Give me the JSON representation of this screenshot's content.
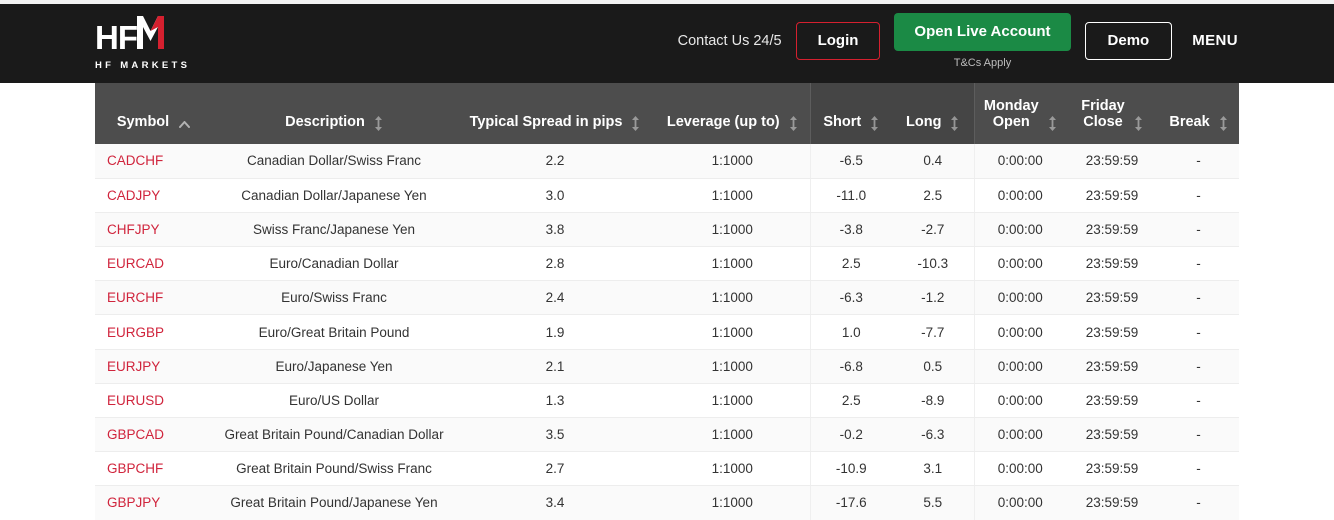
{
  "header": {
    "logo": {
      "mark": "HF",
      "mark_accent": "M",
      "sub": "HF MARKETS"
    },
    "contact_label": "Contact Us 24/5",
    "login_label": "Login",
    "open_live_label": "Open Live Account",
    "tcs_label": "T&Cs Apply",
    "demo_label": "Demo",
    "menu_label": "MENU",
    "colors": {
      "bar_background": "#1a1a1a",
      "login_border": "#d5202f",
      "live_background": "#1b8a45",
      "logo_accent": "#d5202f"
    }
  },
  "table": {
    "columns": [
      {
        "label": "Symbol",
        "sort": "asc",
        "grouped": false
      },
      {
        "label": "Description",
        "sort": "both",
        "grouped": false
      },
      {
        "label": "Typical Spread in pips",
        "sort": "both",
        "grouped": false
      },
      {
        "label": "Leverage (up to)",
        "sort": "both",
        "grouped": false
      },
      {
        "label": "Short",
        "sort": "both",
        "grouped": true
      },
      {
        "label": "Long",
        "sort": "both",
        "grouped": true
      },
      {
        "label": "Monday\nOpen",
        "sort": "both",
        "grouped": false
      },
      {
        "label": "Friday\nClose",
        "sort": "both",
        "grouped": false
      },
      {
        "label": "Break",
        "sort": "both",
        "grouped": false
      }
    ],
    "rows": [
      {
        "symbol": "CADCHF",
        "description": "Canadian Dollar/Swiss Franc",
        "spread": "2.2",
        "leverage": "1:1000",
        "short": "-6.5",
        "long": "0.4",
        "monday_open": "0:00:00",
        "friday_close": "23:59:59",
        "break": "-"
      },
      {
        "symbol": "CADJPY",
        "description": "Canadian Dollar/Japanese Yen",
        "spread": "3.0",
        "leverage": "1:1000",
        "short": "-11.0",
        "long": "2.5",
        "monday_open": "0:00:00",
        "friday_close": "23:59:59",
        "break": "-"
      },
      {
        "symbol": "CHFJPY",
        "description": "Swiss Franc/Japanese Yen",
        "spread": "3.8",
        "leverage": "1:1000",
        "short": "-3.8",
        "long": "-2.7",
        "monday_open": "0:00:00",
        "friday_close": "23:59:59",
        "break": "-"
      },
      {
        "symbol": "EURCAD",
        "description": "Euro/Canadian Dollar",
        "spread": "2.8",
        "leverage": "1:1000",
        "short": "2.5",
        "long": "-10.3",
        "monday_open": "0:00:00",
        "friday_close": "23:59:59",
        "break": "-"
      },
      {
        "symbol": "EURCHF",
        "description": "Euro/Swiss Franc",
        "spread": "2.4",
        "leverage": "1:1000",
        "short": "-6.3",
        "long": "-1.2",
        "monday_open": "0:00:00",
        "friday_close": "23:59:59",
        "break": "-"
      },
      {
        "symbol": "EURGBP",
        "description": "Euro/Great Britain Pound",
        "spread": "1.9",
        "leverage": "1:1000",
        "short": "1.0",
        "long": "-7.7",
        "monday_open": "0:00:00",
        "friday_close": "23:59:59",
        "break": "-"
      },
      {
        "symbol": "EURJPY",
        "description": "Euro/Japanese Yen",
        "spread": "2.1",
        "leverage": "1:1000",
        "short": "-6.8",
        "long": "0.5",
        "monday_open": "0:00:00",
        "friday_close": "23:59:59",
        "break": "-"
      },
      {
        "symbol": "EURUSD",
        "description": "Euro/US Dollar",
        "spread": "1.3",
        "leverage": "1:1000",
        "short": "2.5",
        "long": "-8.9",
        "monday_open": "0:00:00",
        "friday_close": "23:59:59",
        "break": "-"
      },
      {
        "symbol": "GBPCAD",
        "description": "Great Britain Pound/Canadian Dollar",
        "spread": "3.5",
        "leverage": "1:1000",
        "short": "-0.2",
        "long": "-6.3",
        "monday_open": "0:00:00",
        "friday_close": "23:59:59",
        "break": "-"
      },
      {
        "symbol": "GBPCHF",
        "description": "Great Britain Pound/Swiss Franc",
        "spread": "2.7",
        "leverage": "1:1000",
        "short": "-10.9",
        "long": "3.1",
        "monday_open": "0:00:00",
        "friday_close": "23:59:59",
        "break": "-"
      },
      {
        "symbol": "GBPJPY",
        "description": "Great Britain Pound/Japanese Yen",
        "spread": "3.4",
        "leverage": "1:1000",
        "short": "-17.6",
        "long": "5.5",
        "monday_open": "0:00:00",
        "friday_close": "23:59:59",
        "break": "-"
      }
    ]
  }
}
